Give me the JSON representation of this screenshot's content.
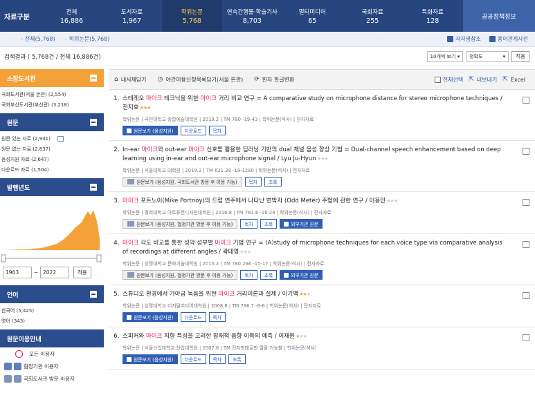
{
  "tabs": {
    "main_label": "자료구분",
    "items": [
      {
        "label": "전체",
        "count": "16,886"
      },
      {
        "label": "도서자료",
        "count": "1,967"
      },
      {
        "label": "학위논문",
        "count": "5,768"
      },
      {
        "label": "연속간행물·학술기사",
        "count": "8,703"
      },
      {
        "label": "멀티미디어",
        "count": "65"
      },
      {
        "label": "국회자료",
        "count": "255"
      },
      {
        "label": "특화자료",
        "count": "128"
      }
    ],
    "policy": "공공정책정보"
  },
  "subtabs": {
    "items": [
      "전체(5,768)",
      "학위논문(5,768)"
    ],
    "right_links": [
      "저자명참조",
      "용어관계사전"
    ]
  },
  "result": {
    "summary": "검색결과 ( 5,768건 / 전체 16,886건)",
    "per_page": "10개씩 보기",
    "sort": "정확도",
    "apply": "적용"
  },
  "sidebar": {
    "library": {
      "title": "소장도서관",
      "items": [
        "국회도서관(서울 본관) (2,554)",
        "국회부산도서관(부산관) (3,218)"
      ]
    },
    "source": {
      "title": "원문",
      "items": [
        "원문 있는 자료 (2,931)",
        "원문 없는 자료 (2,837)",
        "음성지원 자료 (2,647)",
        "다운로드 자료 (1,504)"
      ]
    },
    "year": {
      "title": "발행년도",
      "from": "1963",
      "to": "2022",
      "apply": "적용"
    },
    "language": {
      "title": "언어",
      "items": [
        "한국어 (5,425)",
        "영어 (343)"
      ]
    },
    "guide": {
      "title": "원문이용안내",
      "items": [
        "모든 이용자",
        "협정기관 이용자",
        "국회도서관 방문 이용자"
      ]
    }
  },
  "toolbar": {
    "items": [
      "내서재담기",
      "야간이용신청목록담기(서울 본관)",
      "한자 한글변환"
    ],
    "right": [
      "전체선택",
      "내보내기",
      "Excel"
    ]
  },
  "records": [
    {
      "num": "1.",
      "title_parts": [
        {
          "t": "스테레오 ",
          "h": false
        },
        {
          "t": "마이크",
          "h": true
        },
        {
          "t": " 테크닉을 위한 ",
          "h": false
        },
        {
          "t": "마이크",
          "h": true
        },
        {
          "t": " 거리 비교 연구 = A comparative study on microphone distance for stereo microphone techniques / 전지호",
          "h": false
        }
      ],
      "rating": 2.5,
      "meta": "학위논문 | 국민대학교 종합예술대학원 | 2019.2 | TM 780 -19-43 | 학위논문(석사) | 전자자료",
      "buttons": [
        {
          "label": "원문보기 (음성지원)",
          "style": "blue"
        },
        {
          "label": "다운로드",
          "style": "line"
        },
        {
          "label": "목차",
          "style": "line"
        }
      ]
    },
    {
      "num": "2.",
      "title_parts": [
        {
          "t": "In-ear ",
          "h": false
        },
        {
          "t": "마이크",
          "h": true
        },
        {
          "t": "와 out-ear ",
          "h": false
        },
        {
          "t": "마이크",
          "h": true
        },
        {
          "t": " 신호를 활용한 딥러닝 기반의 dual 채널 음성 향상 기법 = Dual-channel speech enhancement based on deep learning using in-ear and out-ear microphone signal / Lyu Ju-Hyun",
          "h": false
        }
      ],
      "rating": 0,
      "meta": "학위논문 | 서울대학교 대학원 | 2019.2 | TM 621.39 -19-1280 | 학위논문(석사) | 전자자료",
      "buttons": [
        {
          "label": "원문보기 (음성지원, 국회도서관 방문 후 이용 가능)",
          "style": "gray"
        },
        {
          "label": "목차",
          "style": "line"
        },
        {
          "label": "초록",
          "style": "line"
        }
      ]
    },
    {
      "num": "3.",
      "title_parts": [
        {
          "t": "마이크",
          "h": true
        },
        {
          "t": " 포트노이(Mike Portnoy)의 드럼 연주에서 나타난 변박자 (Odd Meter) 주법에 관한 연구 / 이용민",
          "h": false
        }
      ],
      "rating": 0,
      "meta": "학위논문 | 경희대학교 아트퓨전디자인대학원 | 2016.8 | TM 781.6 -16-26 | 학위논문(석사) | 전자자료",
      "buttons": [
        {
          "label": "원문보기 (음성지원, 협정기관 방문 후 이용 가능)",
          "style": "gray"
        },
        {
          "label": "목차",
          "style": "line"
        },
        {
          "label": "초록",
          "style": "line"
        },
        {
          "label": "외부기관 원문",
          "style": "blue"
        }
      ]
    },
    {
      "num": "4.",
      "title_parts": [
        {
          "t": "마이크",
          "h": true
        },
        {
          "t": " 각도 비교를 통한 성악 성부별 ",
          "h": false
        },
        {
          "t": "마이크",
          "h": true
        },
        {
          "t": " 기법 연구 = (A)study of microphone techniques for each voice type via comparative analysis of recordings at different angles / 곽태영",
          "h": false
        }
      ],
      "rating": 0,
      "meta": "학위논문 | 상명대학교 문화기술대학원 | 2015.2 | TM 780.266 -15-17 | 학위논문(석사) | 전자자료",
      "buttons": [
        {
          "label": "원문보기 (음성지원, 협정기관 방문 후 이용 가능)",
          "style": "gray"
        },
        {
          "label": "목차",
          "style": "line"
        },
        {
          "label": "초록",
          "style": "line"
        },
        {
          "label": "외부기관 원문",
          "style": "blue"
        }
      ]
    },
    {
      "num": "5.",
      "title_parts": [
        {
          "t": "스튜디오 환경에서 가야금 녹음을 위한 ",
          "h": false
        },
        {
          "t": "마이크",
          "h": true
        },
        {
          "t": " 거리이론과 실제 / 이기백",
          "h": false
        }
      ],
      "rating": 2,
      "meta": "학위논문 | 상명대학교 디지털미디어대학원 | 2008.8 | TM 786.7 -8-6 | 학위논문(석사) | 전자자료",
      "buttons": [
        {
          "label": "원문보기 (음성지원)",
          "style": "blue"
        },
        {
          "label": "다운로드",
          "style": "line"
        },
        {
          "label": "목차",
          "style": "line"
        }
      ]
    },
    {
      "num": "6.",
      "title_parts": [
        {
          "t": "스피커와 ",
          "h": false
        },
        {
          "t": "마이크",
          "h": true
        },
        {
          "t": " 지향 특성을 고려한 잠재적 음향 이득의 예측 / 이재원",
          "h": false
        }
      ],
      "rating": 1,
      "meta": "학위논문 | 서울산업대학교 산업대학원 | 2007.8 | TM 전자형태로만 열람 가능함 | 학위논문(석사)",
      "buttons": [
        {
          "label": "원문보기 (음성지원)",
          "style": "blue"
        },
        {
          "label": "다운로드",
          "style": "line"
        },
        {
          "label": "목차",
          "style": "line"
        },
        {
          "label": "초록",
          "style": "line"
        }
      ]
    }
  ],
  "colors": {
    "tabbar": "#27467f",
    "highlight": "#e0195d",
    "accent_orange": "#f5a13a",
    "button_blue": "#2f5fb5"
  }
}
